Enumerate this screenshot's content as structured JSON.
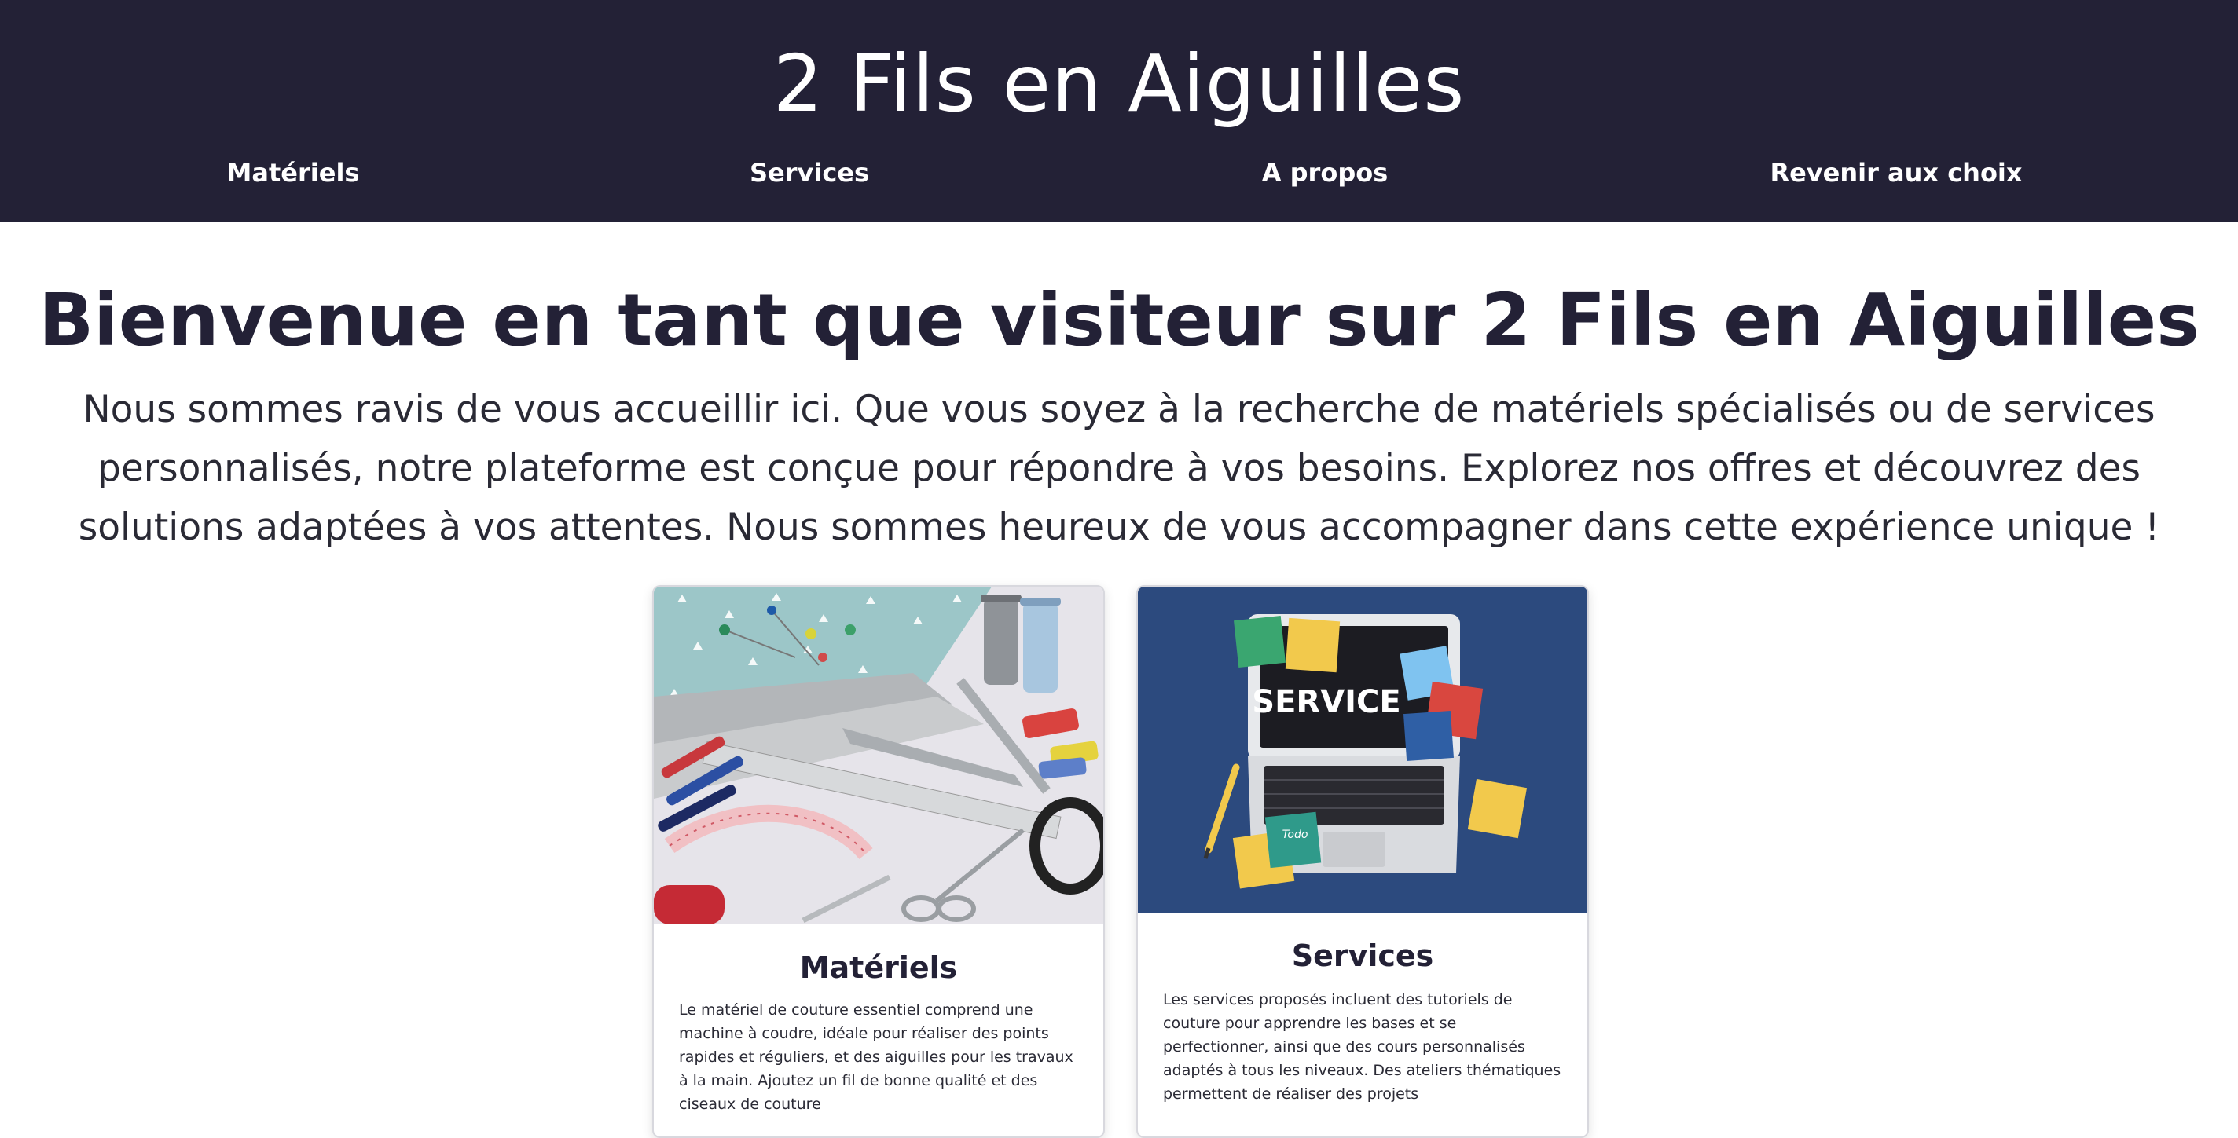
{
  "header": {
    "title": "2 Fils en Aiguilles",
    "nav": [
      {
        "label": "Matériels"
      },
      {
        "label": "Services"
      },
      {
        "label": "A propos"
      },
      {
        "label": "Revenir aux choix"
      }
    ]
  },
  "main": {
    "welcome_title": "Bienvenue en tant que visiteur sur 2 Fils en Aiguilles",
    "intro": "Nous sommes ravis de vous accueillir ici. Que vous soyez à la recherche de matériels spécialisés ou de services personnalisés, notre plateforme est conçue pour répondre à vos besoins. Explorez nos offres et découvrez des solutions adaptées à vos attentes. Nous sommes heureux de vous accompagner dans cette expérience unique !",
    "cards": [
      {
        "title": "Matériels",
        "text": "Le matériel de couture essentiel comprend une machine à coudre, idéale pour réaliser des points rapides et réguliers, et des aiguilles pour les travaux à la main. Ajoutez un fil de bonne qualité et des ciseaux de couture"
      },
      {
        "title": "Services",
        "text": "Les services proposés incluent des tutoriels de couture pour apprendre les bases et se perfectionner, ainsi que des cours personnalisés adaptés à tous les niveaux. Des ateliers thématiques permettent de réaliser des projets"
      }
    ]
  },
  "images": {
    "services_sign": "SERVICE",
    "todo_note": "Todo"
  },
  "colors": {
    "header_bg": "#232136",
    "accent_text": "#232136",
    "services_bg": "#2c4a7e"
  }
}
